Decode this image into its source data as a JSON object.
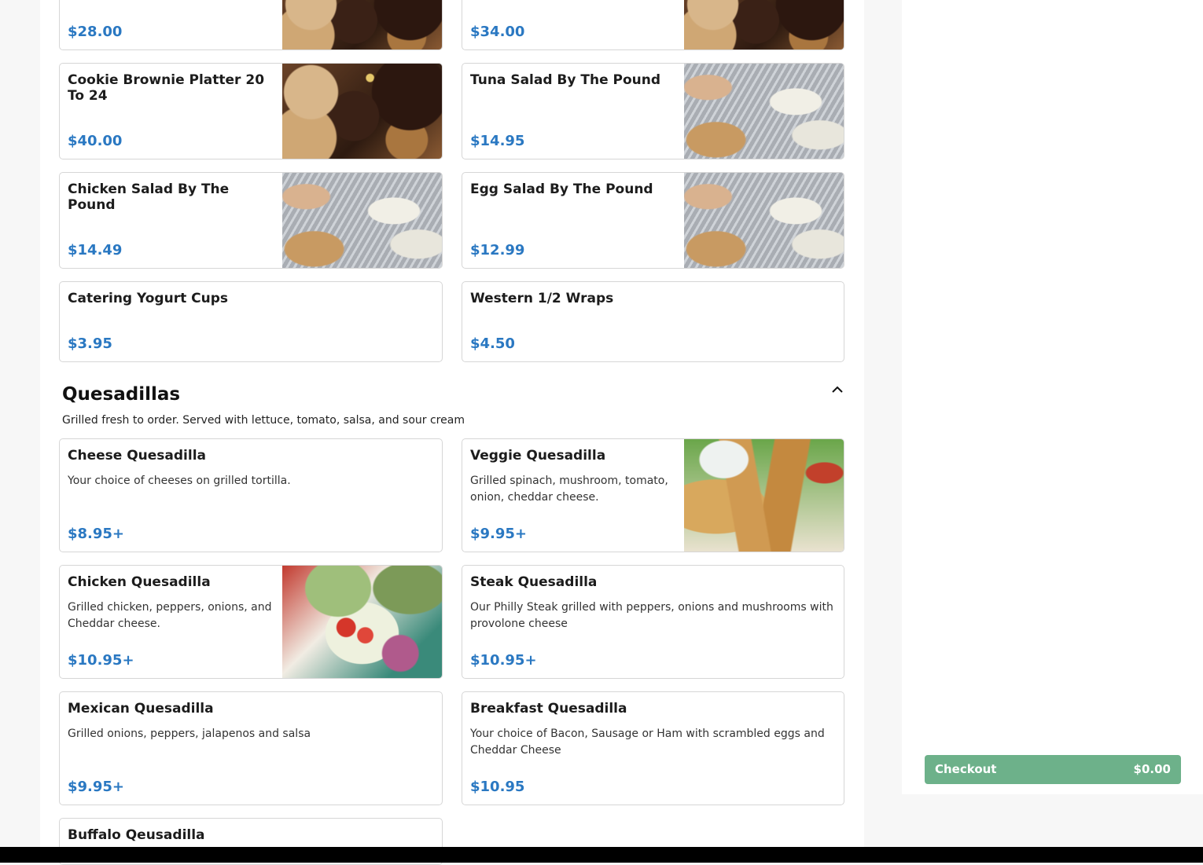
{
  "menu": {
    "upper_cards": [
      {
        "name": "",
        "price": "$28.00"
      },
      {
        "name": "",
        "price": "$34.00"
      },
      {
        "name": "Cookie Brownie Platter 20 To 24",
        "price": "$40.00"
      },
      {
        "name": "Tuna Salad By The Pound",
        "price": "$14.95"
      },
      {
        "name": "Chicken Salad By The Pound",
        "price": "$14.49"
      },
      {
        "name": "Egg Salad By The Pound",
        "price": "$12.99"
      },
      {
        "name": "Catering Yogurt Cups",
        "price": "$3.95"
      },
      {
        "name": "Western 1/2 Wraps",
        "price": "$4.50"
      }
    ]
  },
  "section": {
    "title": "Quesadillas",
    "description": "Grilled fresh to order. Served with lettuce, tomato, salsa, and sour cream",
    "toggle_icon": "chevron-up-icon",
    "items": [
      {
        "name": "Cheese Quesadilla",
        "description": "Your choice of cheeses on grilled tortilla.",
        "price": "$8.95+"
      },
      {
        "name": "Veggie Quesadilla",
        "description": "Grilled spinach, mushroom, tomato, onion, cheddar cheese.",
        "price": "$9.95+"
      },
      {
        "name": "Chicken Quesadilla",
        "description": "Grilled chicken, peppers, onions, and Cheddar cheese.",
        "price": "$10.95+"
      },
      {
        "name": "Steak Quesadilla",
        "description": "Our Philly Steak grilled with peppers, onions and mushrooms with provolone cheese",
        "price": "$10.95+"
      },
      {
        "name": "Mexican Quesadilla",
        "description": "Grilled onions, peppers, jalapenos and salsa",
        "price": "$9.95+"
      },
      {
        "name": "Breakfast Quesadilla",
        "description": "Your choice of Bacon, Sausage or Ham with scrambled eggs and Cheddar Cheese",
        "price": "$10.95"
      },
      {
        "name": "Buffalo Qeusadilla",
        "description": "",
        "price": ""
      }
    ]
  },
  "cart": {
    "checkout_label": "Checkout",
    "total": "$0.00"
  },
  "colors": {
    "price": "#2a78c2",
    "checkout": "#6db18a"
  }
}
